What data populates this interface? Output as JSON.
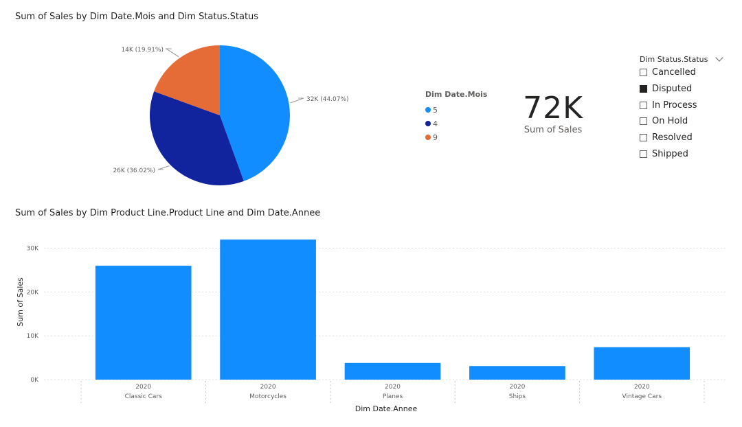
{
  "pie_chart": {
    "title": "Sum of Sales by Dim Date.Mois and Dim Status.Status",
    "legend_title": "Dim Date.Mois"
  },
  "card": {
    "value": "72K",
    "label": "Sum of Sales"
  },
  "slicer": {
    "header": "Dim Status.Status",
    "items": [
      {
        "label": "Cancelled",
        "checked": false
      },
      {
        "label": "Disputed",
        "checked": true
      },
      {
        "label": "In Process",
        "checked": false
      },
      {
        "label": "On Hold",
        "checked": false
      },
      {
        "label": "Resolved",
        "checked": false
      },
      {
        "label": "Shipped",
        "checked": false
      }
    ]
  },
  "bar_chart": {
    "title": "Sum of Sales by Dim Product Line.Product Line and Dim Date.Annee"
  },
  "colors": {
    "month5": "#118dff",
    "month4": "#12239e",
    "month9": "#e66c37",
    "bar": "#118dff"
  },
  "chart_data": [
    {
      "type": "pie",
      "title": "Sum of Sales by Dim Date.Mois and Dim Status.Status",
      "legend_title": "Dim Date.Mois",
      "slices": [
        {
          "name": "5",
          "value": 32,
          "label": "32K (44.07%)",
          "color": "#118dff"
        },
        {
          "name": "4",
          "value": 26,
          "label": "26K (36.02%)",
          "color": "#12239e"
        },
        {
          "name": "9",
          "value": 14,
          "label": "14K (19.91%)",
          "color": "#e66c37"
        }
      ]
    },
    {
      "type": "bar",
      "title": "Sum of Sales by Dim Product Line.Product Line and Dim Date.Annee",
      "xlabel": "Dim Date.Annee",
      "ylabel": "Sum of Sales",
      "ylim": [
        0,
        33000
      ],
      "yticks": [
        {
          "value": 0,
          "label": "0K"
        },
        {
          "value": 10000,
          "label": "10K"
        },
        {
          "value": 20000,
          "label": "20K"
        },
        {
          "value": 30000,
          "label": "30K"
        }
      ],
      "grid": true,
      "categories": [
        {
          "year": "2020",
          "product": "Classic Cars"
        },
        {
          "year": "2020",
          "product": "Motorcycles"
        },
        {
          "year": "2020",
          "product": "Planes"
        },
        {
          "year": "2020",
          "product": "Ships"
        },
        {
          "year": "2020",
          "product": "Vintage Cars"
        }
      ],
      "values": [
        26000,
        32000,
        3800,
        3100,
        7400
      ]
    }
  ]
}
